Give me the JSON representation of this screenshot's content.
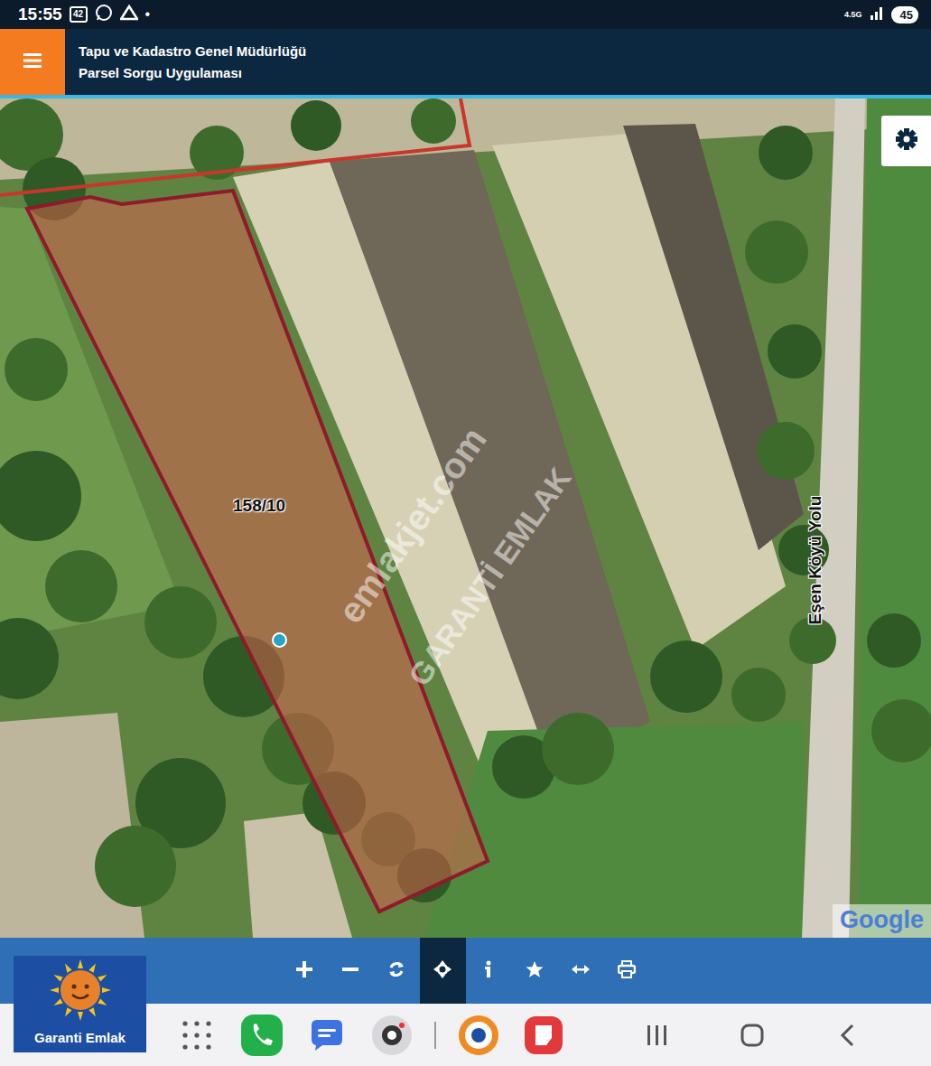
{
  "status_bar": {
    "time": "15:55",
    "notification_badge": "42",
    "dot": "•",
    "network": "4.5G",
    "battery": "45"
  },
  "header": {
    "title": "Tapu ve Kadastro Genel Müdürlüğü",
    "subtitle": "Parsel Sorgu Uygulaması"
  },
  "map": {
    "parcel_label": "158/10",
    "road_label": "Eşen Köyü Yolu",
    "attribution": "Google",
    "watermarks": [
      "emlakjet.com",
      "GARANTİ EMLAK"
    ]
  },
  "toolbar": {
    "tools": [
      {
        "kind": "plus",
        "selected": false
      },
      {
        "kind": "minus",
        "selected": false
      },
      {
        "kind": "refresh",
        "selected": false
      },
      {
        "kind": "locate",
        "selected": true
      },
      {
        "kind": "info",
        "selected": false
      },
      {
        "kind": "star",
        "selected": false
      },
      {
        "kind": "measure",
        "selected": false
      },
      {
        "kind": "print",
        "selected": false
      }
    ]
  },
  "logo": {
    "text": "Garanti Emlak"
  },
  "nav_bar": {
    "apps": [
      {
        "kind": "grid"
      },
      {
        "kind": "phone"
      },
      {
        "kind": "messages"
      },
      {
        "kind": "camera"
      },
      {
        "kind": "tkgm"
      },
      {
        "kind": "notes"
      }
    ],
    "system_buttons": [
      {
        "kind": "recents"
      },
      {
        "kind": "home"
      },
      {
        "kind": "back"
      }
    ]
  }
}
